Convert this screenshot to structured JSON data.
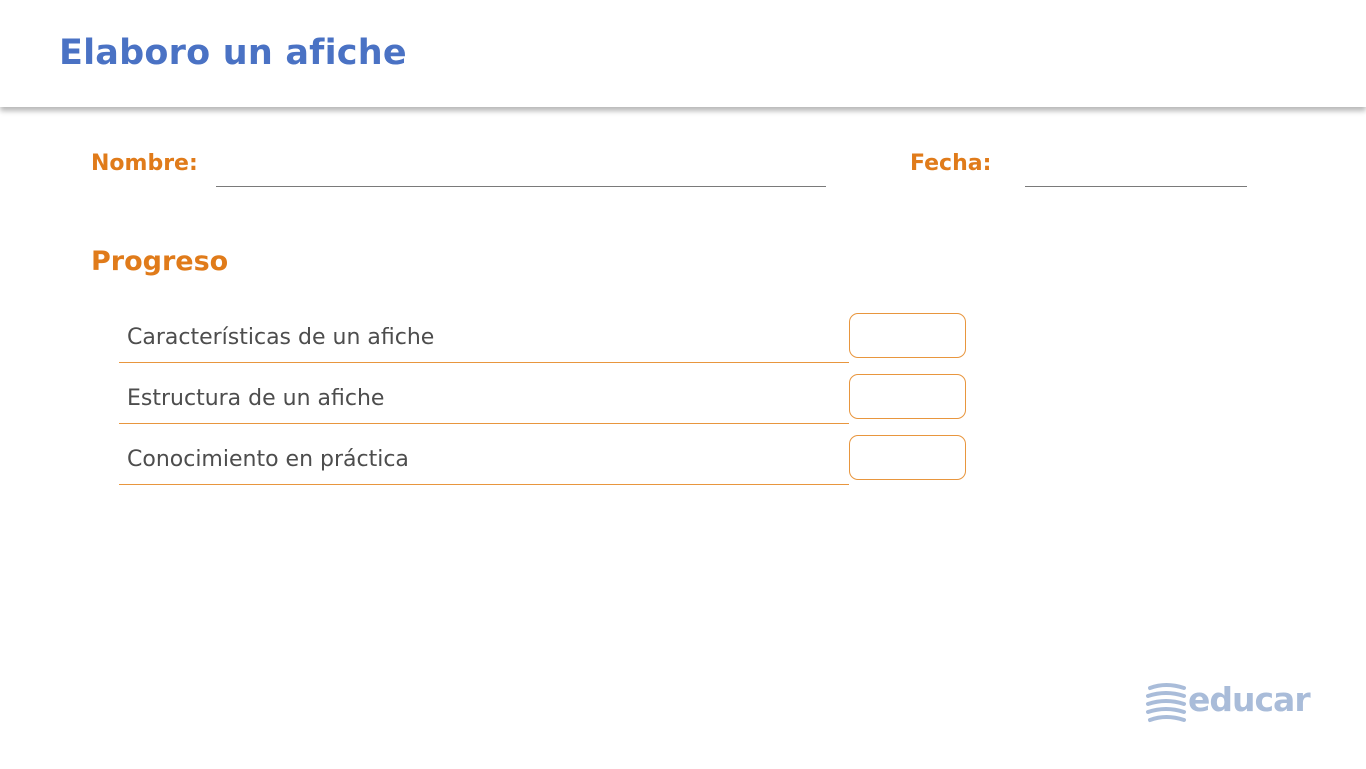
{
  "header": {
    "title": "Elaboro un afiche"
  },
  "form": {
    "name_label": "Nombre:",
    "date_label": "Fecha:"
  },
  "progress": {
    "title": "Progreso",
    "items": [
      {
        "label": "Características de un afiche"
      },
      {
        "label": "Estructura de un afiche"
      },
      {
        "label": "Conocimiento en práctica"
      }
    ]
  },
  "logo": {
    "text": "educar"
  },
  "colors": {
    "title_blue": "#4a72c4",
    "accent_orange": "#e07b1a",
    "logo_blue": "#a9bcd9"
  }
}
